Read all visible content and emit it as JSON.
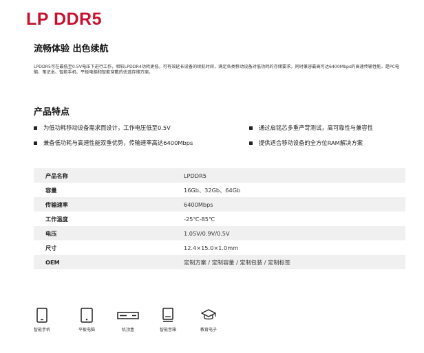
{
  "title": "LP DDR5",
  "subtitle": "流畅体验 出色续航",
  "intro": "LPDDR5可在最低至0.5V电压下进行工作，相较LPDDR4功耗更低，可有效延长设备的续航时间，满足各类移动设备对低功耗的存储要求，同时兼容最高可达6400Mbps的高速传输性能，是PC电脑、笔记本、智能手机、平板电脑和智能穿戴的优选存储方案。",
  "features_title": "产品特点",
  "features": [
    "为低功耗移动设备需求而设计，工作电压低至0.5V",
    "通过启铭芯多重严苛测试，高可靠性与兼容性",
    "兼备低功耗与高速性能双重优势，传输速率高达6400Mbps",
    "提供适合移动设备的全方位RAM解决方案"
  ],
  "specs": [
    {
      "key": "产品名称",
      "value": "LPDDR5"
    },
    {
      "key": "容量",
      "value": "16Gb、32Gb、64Gb"
    },
    {
      "key": "传输速率",
      "value": "6400Mbps"
    },
    {
      "key": "工作温度",
      "value": "-25℃-85℃"
    },
    {
      "key": "电压",
      "value": "1.05V/0.9V/0.5V"
    },
    {
      "key": "尺寸",
      "value": "12.4×15.0×1.0mm"
    },
    {
      "key": "OEM",
      "value": "定制方案 / 定制容量 / 定制包装 / 定制标签"
    }
  ],
  "applications": [
    {
      "label": "智能手机",
      "icon": "smartphone-icon"
    },
    {
      "label": "平板电脑",
      "icon": "tablet-icon"
    },
    {
      "label": "机顶盒",
      "icon": "set-top-box-icon"
    },
    {
      "label": "智能音箱",
      "icon": "smart-speaker-icon"
    },
    {
      "label": "教育电子",
      "icon": "graduation-cap-icon"
    }
  ]
}
